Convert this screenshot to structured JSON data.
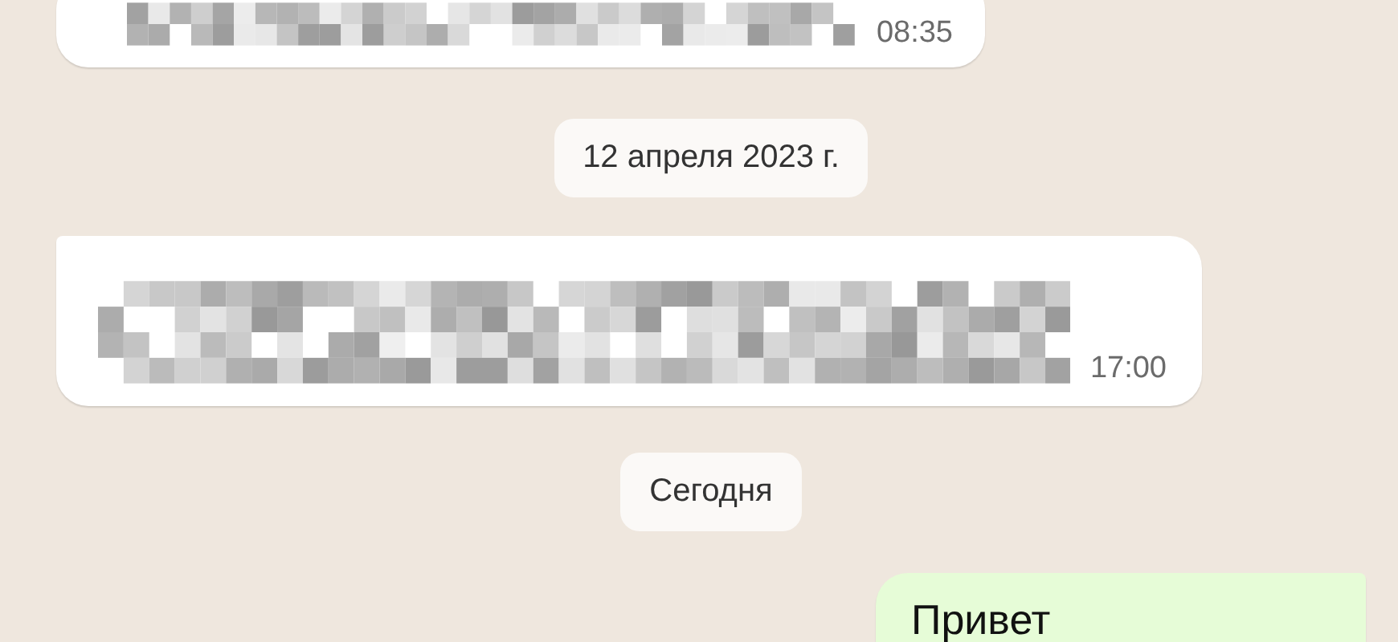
{
  "messages": [
    {
      "kind": "redacted",
      "outgoing": false,
      "time": "08:35"
    },
    {
      "kind": "date",
      "label": "12 апреля 2023 г."
    },
    {
      "kind": "redacted",
      "outgoing": false,
      "time": "17:00"
    },
    {
      "kind": "date",
      "label": "Сегодня"
    },
    {
      "kind": "text",
      "outgoing": true,
      "text": "Привет"
    }
  ]
}
